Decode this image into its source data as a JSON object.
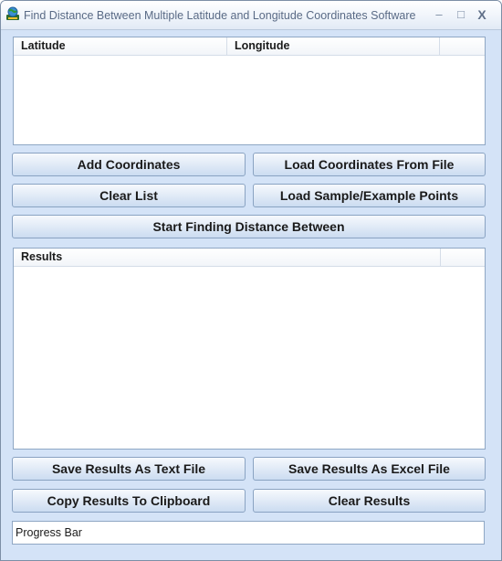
{
  "window": {
    "title": "Find Distance Between Multiple Latitude and Longitude Coordinates Software",
    "min_glyph": "–",
    "max_glyph": "□",
    "close_glyph": "X"
  },
  "coordinates_list": {
    "columns": [
      "Latitude",
      "Longitude"
    ],
    "rows": []
  },
  "buttons": {
    "add_coordinates": "Add Coordinates",
    "load_from_file": "Load Coordinates From File",
    "clear_list": "Clear List",
    "load_sample": "Load Sample/Example Points",
    "start_finding": "Start Finding Distance Between",
    "save_text": "Save Results As Text File",
    "save_excel": "Save Results As Excel File",
    "copy_clipboard": "Copy Results To Clipboard",
    "clear_results": "Clear Results"
  },
  "results_list": {
    "columns": [
      "Results"
    ],
    "rows": []
  },
  "progress": {
    "label": "Progress Bar",
    "value": 0
  },
  "colors": {
    "window_bg": "#d4e3f7",
    "border": "#8fa7c4"
  },
  "icons": {
    "app": "globe-app-icon"
  }
}
